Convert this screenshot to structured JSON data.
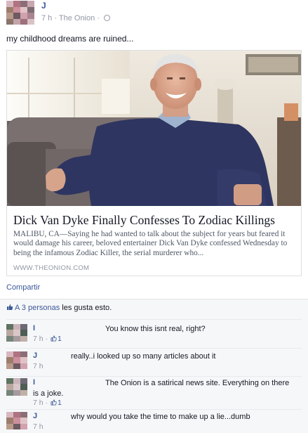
{
  "post": {
    "author": "J",
    "time": "7 h",
    "separator": " · ",
    "source": "The Onion",
    "separator2": " · ",
    "text": "my childhood dreams are ruined..."
  },
  "card": {
    "title": "Dick Van Dyke Finally Confesses To Zodiac Killings",
    "description": "MALIBU, CA—Saying he had wanted to talk about the subject for years but feared it would damage his career, beloved entertainer Dick Van Dyke confessed Wednesday to being the infamous Zodiac Killer, the serial murderer who...",
    "domain": "WWW.THEONION.COM"
  },
  "actions": {
    "share": "Compartir"
  },
  "likes": {
    "count_link": "A 3 personas",
    "rest": " les gusta esto."
  },
  "comments": [
    {
      "author": "I",
      "text": "You know this isnt real, right?",
      "time": "7 h",
      "likes": "1"
    },
    {
      "author": "J",
      "text": "really..i looked up so many articles about it",
      "time": "7 h",
      "likes": ""
    },
    {
      "author": "I",
      "text": "The Onion is a satirical news site. Everything on there is a joke.",
      "time": "7 h",
      "likes": "1"
    },
    {
      "author": "J",
      "text": "why would you take the time to make up a lie...dumb",
      "time": "7 h",
      "likes": ""
    }
  ],
  "colors": {
    "link": "#3b5998",
    "meta": "#9197a3",
    "sweater": "#2e3560",
    "sofa": "#5d5555"
  },
  "icons": [
    "globe-icon",
    "like-thumb-icon"
  ]
}
